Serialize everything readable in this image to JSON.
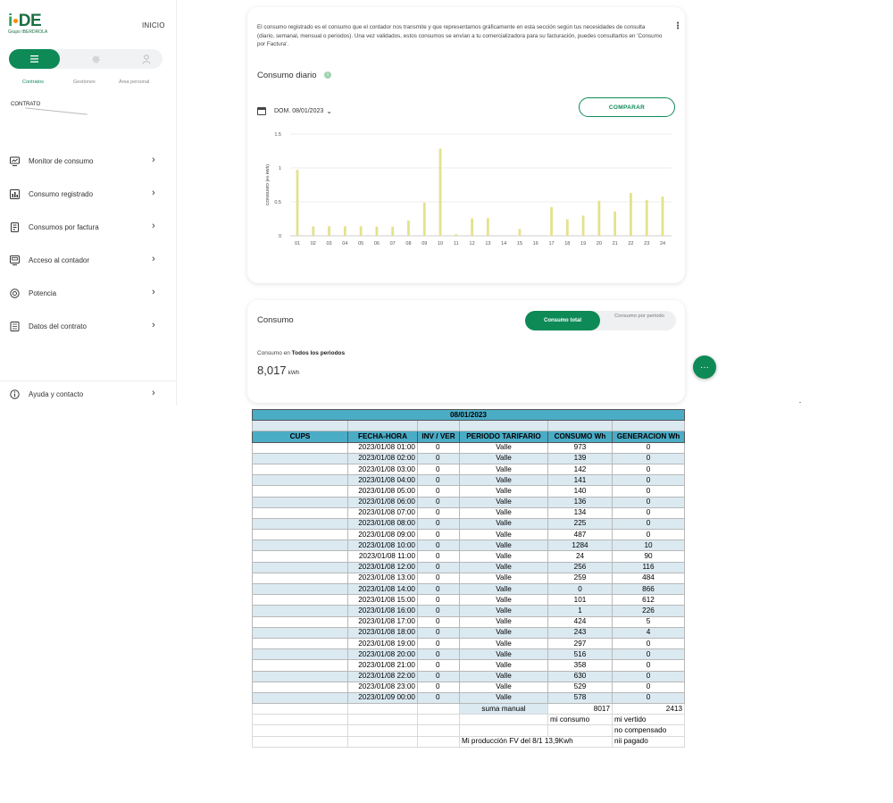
{
  "sidebar": {
    "logo_main": "DE",
    "logo_i": "i",
    "logo_sub": "Grupo IBERDROLA",
    "inicio_label": "INICIO",
    "segments": [
      {
        "label": "Contratos",
        "icon": "menu-icon"
      },
      {
        "label": "Gestiones",
        "icon": "gear-icon"
      },
      {
        "label": "Área personal",
        "icon": "user-icon"
      }
    ],
    "contrato_label": "CONTRATO",
    "menu": [
      {
        "label": "Monitor de consumo",
        "icon": "monitor-icon"
      },
      {
        "label": "Consumo registrado",
        "icon": "chart-icon"
      },
      {
        "label": "Consumos por factura",
        "icon": "invoice-icon"
      },
      {
        "label": "Acceso al contador",
        "icon": "meter-icon"
      },
      {
        "label": "Potencia",
        "icon": "power-icon"
      },
      {
        "label": "Datos del contrato",
        "icon": "document-icon"
      }
    ],
    "help_label": "Ayuda y contacto"
  },
  "consumo_registrado": {
    "intro": "El consumo registrado es el consumo que el contador nos transmite y que representamos gráficamente en esta sección según tus necesidades de consulta (diario, semanal, mensual o periodos). Una vez validados, estos consumos se envían a tu comercializadora para su facturación, puedes consultarlos en 'Consumo por Factura'.",
    "title": "Consumo diario",
    "date_label": "DOM. 08/01/2023",
    "compare_label": "COMPARAR"
  },
  "chart_data": {
    "type": "bar",
    "ylabel": "CONSUMO (en kWh)",
    "ylim": [
      0,
      1.5
    ],
    "yticks": [
      "0",
      "0.5",
      "1",
      "1.5"
    ],
    "categories": [
      "01",
      "02",
      "03",
      "04",
      "05",
      "06",
      "07",
      "08",
      "09",
      "10",
      "11",
      "12",
      "13",
      "14",
      "15",
      "16",
      "17",
      "18",
      "19",
      "20",
      "21",
      "22",
      "23",
      "24"
    ],
    "values": [
      0.973,
      0.139,
      0.142,
      0.141,
      0.14,
      0.136,
      0.134,
      0.225,
      0.487,
      1.284,
      0.024,
      0.256,
      0.259,
      0,
      0.101,
      0.001,
      0.424,
      0.243,
      0.297,
      0.516,
      0.358,
      0.63,
      0.529,
      0.578
    ],
    "bar_color": "#e3e28c",
    "grid": true
  },
  "consumo_card": {
    "title": "Consumo",
    "toggle_active": "Consumo total",
    "toggle_other": "Consumo por periodo",
    "sub_prefix": "Consumo en ",
    "sub_bold": "Todos los periodos",
    "value": "8,017",
    "unit": "kWh"
  },
  "sheet": {
    "title": "08/01/2023",
    "headers": [
      "CUPS",
      "FECHA-HORA",
      "INV / VER",
      "PERIODO TARIFARIO",
      "CONSUMO Wh",
      "GENERACION Wh"
    ],
    "rows": [
      [
        "",
        "2023/01/08 01:00",
        "0",
        "Valle",
        "973",
        "0"
      ],
      [
        "",
        "2023/01/08 02:00",
        "0",
        "Valle",
        "139",
        "0"
      ],
      [
        "",
        "2023/01/08 03:00",
        "0",
        "Valle",
        "142",
        "0"
      ],
      [
        "",
        "2023/01/08 04:00",
        "0",
        "Valle",
        "141",
        "0"
      ],
      [
        "",
        "2023/01/08 05:00",
        "0",
        "Valle",
        "140",
        "0"
      ],
      [
        "",
        "2023/01/08 06:00",
        "0",
        "Valle",
        "136",
        "0"
      ],
      [
        "",
        "2023/01/08 07:00",
        "0",
        "Valle",
        "134",
        "0"
      ],
      [
        "",
        "2023/01/08 08:00",
        "0",
        "Valle",
        "225",
        "0"
      ],
      [
        "",
        "2023/01/08 09:00",
        "0",
        "Valle",
        "487",
        "0"
      ],
      [
        "",
        "2023/01/08 10:00",
        "0",
        "Valle",
        "1284",
        "10"
      ],
      [
        "",
        "2023/01/08 11:00",
        "0",
        "Valle",
        "24",
        "90"
      ],
      [
        "",
        "2023/01/08 12:00",
        "0",
        "Valle",
        "256",
        "116"
      ],
      [
        "",
        "2023/01/08 13:00",
        "0",
        "Valle",
        "259",
        "484"
      ],
      [
        "",
        "2023/01/08 14:00",
        "0",
        "Valle",
        "0",
        "866"
      ],
      [
        "",
        "2023/01/08 15:00",
        "0",
        "Valle",
        "101",
        "612"
      ],
      [
        "",
        "2023/01/08 16:00",
        "0",
        "Valle",
        "1",
        "226"
      ],
      [
        "",
        "2023/01/08 17:00",
        "0",
        "Valle",
        "424",
        "5"
      ],
      [
        "",
        "2023/01/08 18:00",
        "0",
        "Valle",
        "243",
        "4"
      ],
      [
        "",
        "2023/01/08 19:00",
        "0",
        "Valle",
        "297",
        "0"
      ],
      [
        "",
        "2023/01/08 20:00",
        "0",
        "Valle",
        "516",
        "0"
      ],
      [
        "",
        "2023/01/08 21:00",
        "0",
        "Valle",
        "358",
        "0"
      ],
      [
        "",
        "2023/01/08 22:00",
        "0",
        "Valle",
        "630",
        "0"
      ],
      [
        "",
        "2023/01/08 23:00",
        "0",
        "Valle",
        "529",
        "0"
      ],
      [
        "",
        "2023/01/09 00:00",
        "0",
        "Valle",
        "578",
        "0"
      ]
    ],
    "suma_label": "suma manual",
    "suma_consumo": "8017",
    "suma_generacion": "2413",
    "mi_consumo": "mi consumo",
    "mi_vertido": "mi vertido",
    "no_compensado": "no compensado",
    "produccion": "Mi producción FV del 8/1 13,9Kwh",
    "pagado": "nii pagado"
  }
}
